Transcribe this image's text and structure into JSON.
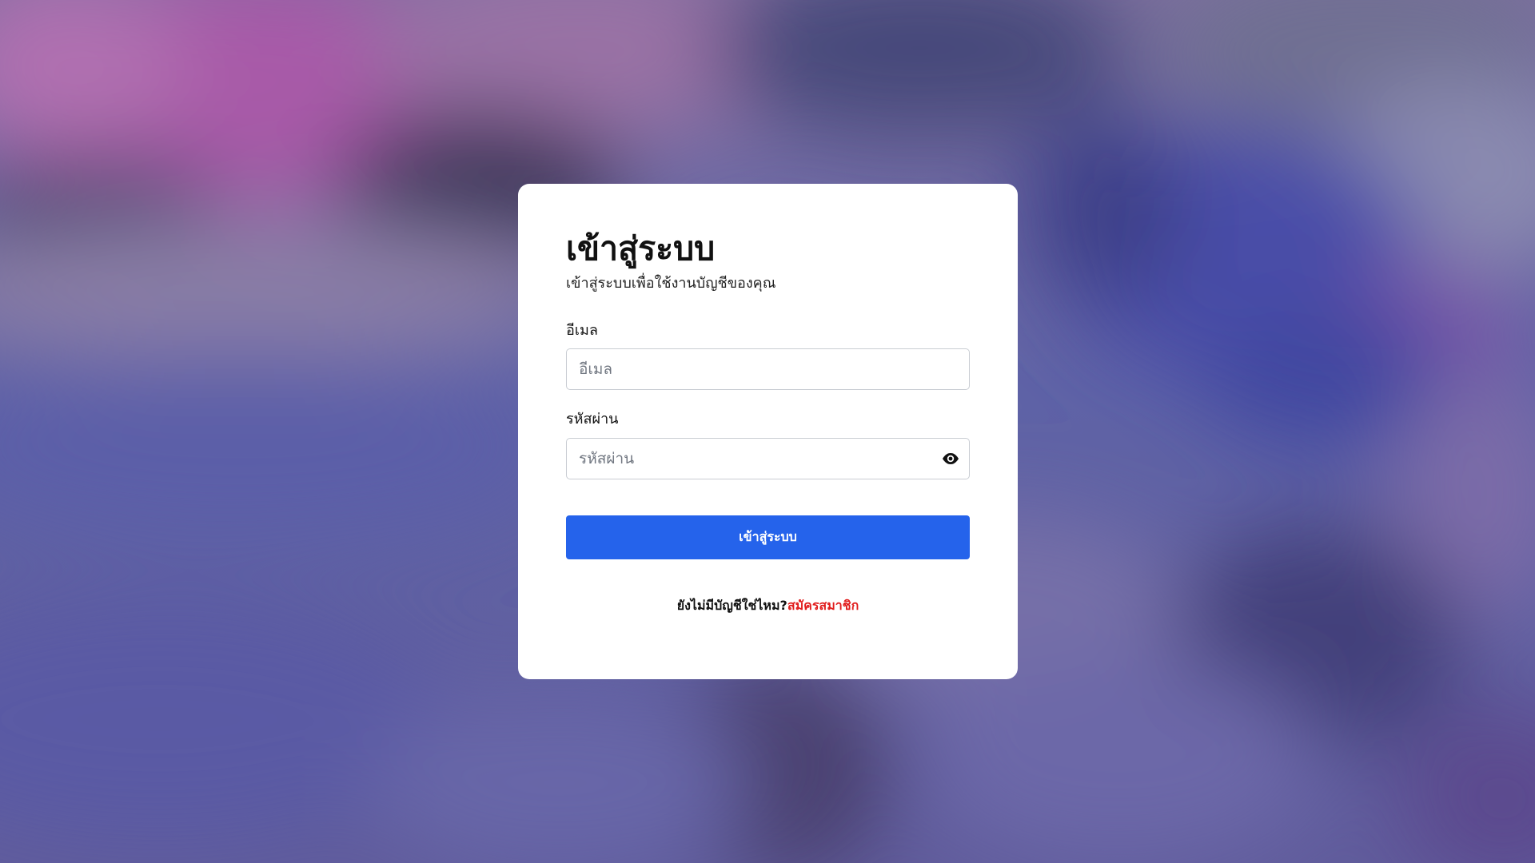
{
  "colors": {
    "primary_button": "#2563eb",
    "signup_link": "#e11d1d",
    "card_background": "#ffffff"
  },
  "login": {
    "title": "เข้าสู่ระบบ",
    "subtitle": "เข้าสู่ระบบเพื่อใช้งานบัญชีของคุณ",
    "email": {
      "label": "อีเมล",
      "placeholder": "อีเมล",
      "value": ""
    },
    "password": {
      "label": "รหัสผ่าน",
      "placeholder": "รหัสผ่าน",
      "value": "",
      "toggle_icon": "eye-icon"
    },
    "submit_label": "เข้าสู่ระบบ",
    "no_account_text": "ยังไม่มีบัญชีใช่ไหม?",
    "signup_label": "สมัครสมาชิก"
  }
}
